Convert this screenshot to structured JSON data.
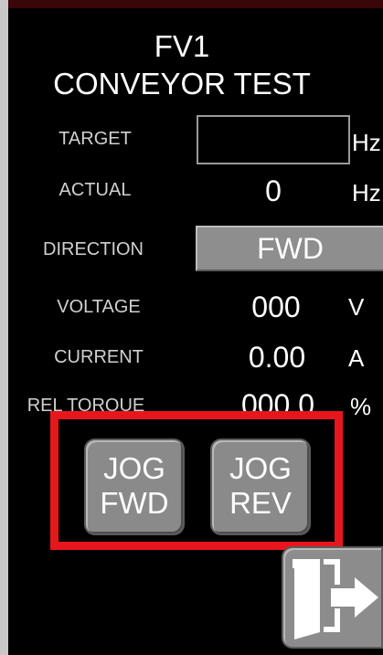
{
  "screen": {
    "title_line1": "FV1",
    "title_line2": "CONVEYOR TEST"
  },
  "fields": {
    "target_label": "TARGET",
    "target_value": "",
    "target_unit": "Hz",
    "actual_label": "ACTUAL",
    "actual_value": "0",
    "actual_unit": "Hz",
    "direction_label": "DIRECTION",
    "direction_value": "FWD",
    "voltage_label": "VOLTAGE",
    "voltage_value": "000",
    "voltage_unit": "V",
    "current_label": "CURRENT",
    "current_value": "0.00",
    "current_unit": "A",
    "torque_label": "REL TORQUE",
    "torque_value": "000.0",
    "torque_unit": "%"
  },
  "buttons": {
    "jog_fwd_line1": "JOG",
    "jog_fwd_line2": "FWD",
    "jog_rev_line1": "JOG",
    "jog_rev_line2": "REV",
    "exit_icon": "exit-door-icon"
  },
  "colors": {
    "highlight_frame": "#e8161c",
    "button_gray": "#8a8a8a",
    "panel_bg": "#000000"
  }
}
